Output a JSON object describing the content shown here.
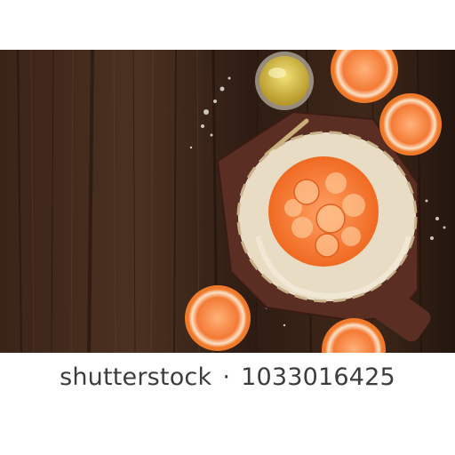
{
  "watermark": {
    "brand": "shutterstock",
    "separator": "·",
    "image_number": "1033016425"
  },
  "scene": {
    "icons": [
      "wooden-table",
      "cutting-board",
      "orange-galette",
      "orange-half",
      "olive-oil-jar",
      "flour-dusting"
    ],
    "colors": {
      "wood_dark": "#2a1a12",
      "wood_mid": "#4a3020",
      "orange": "#f47a35",
      "pastry": "#e8dcc4",
      "oil": "#d9c24a"
    }
  }
}
